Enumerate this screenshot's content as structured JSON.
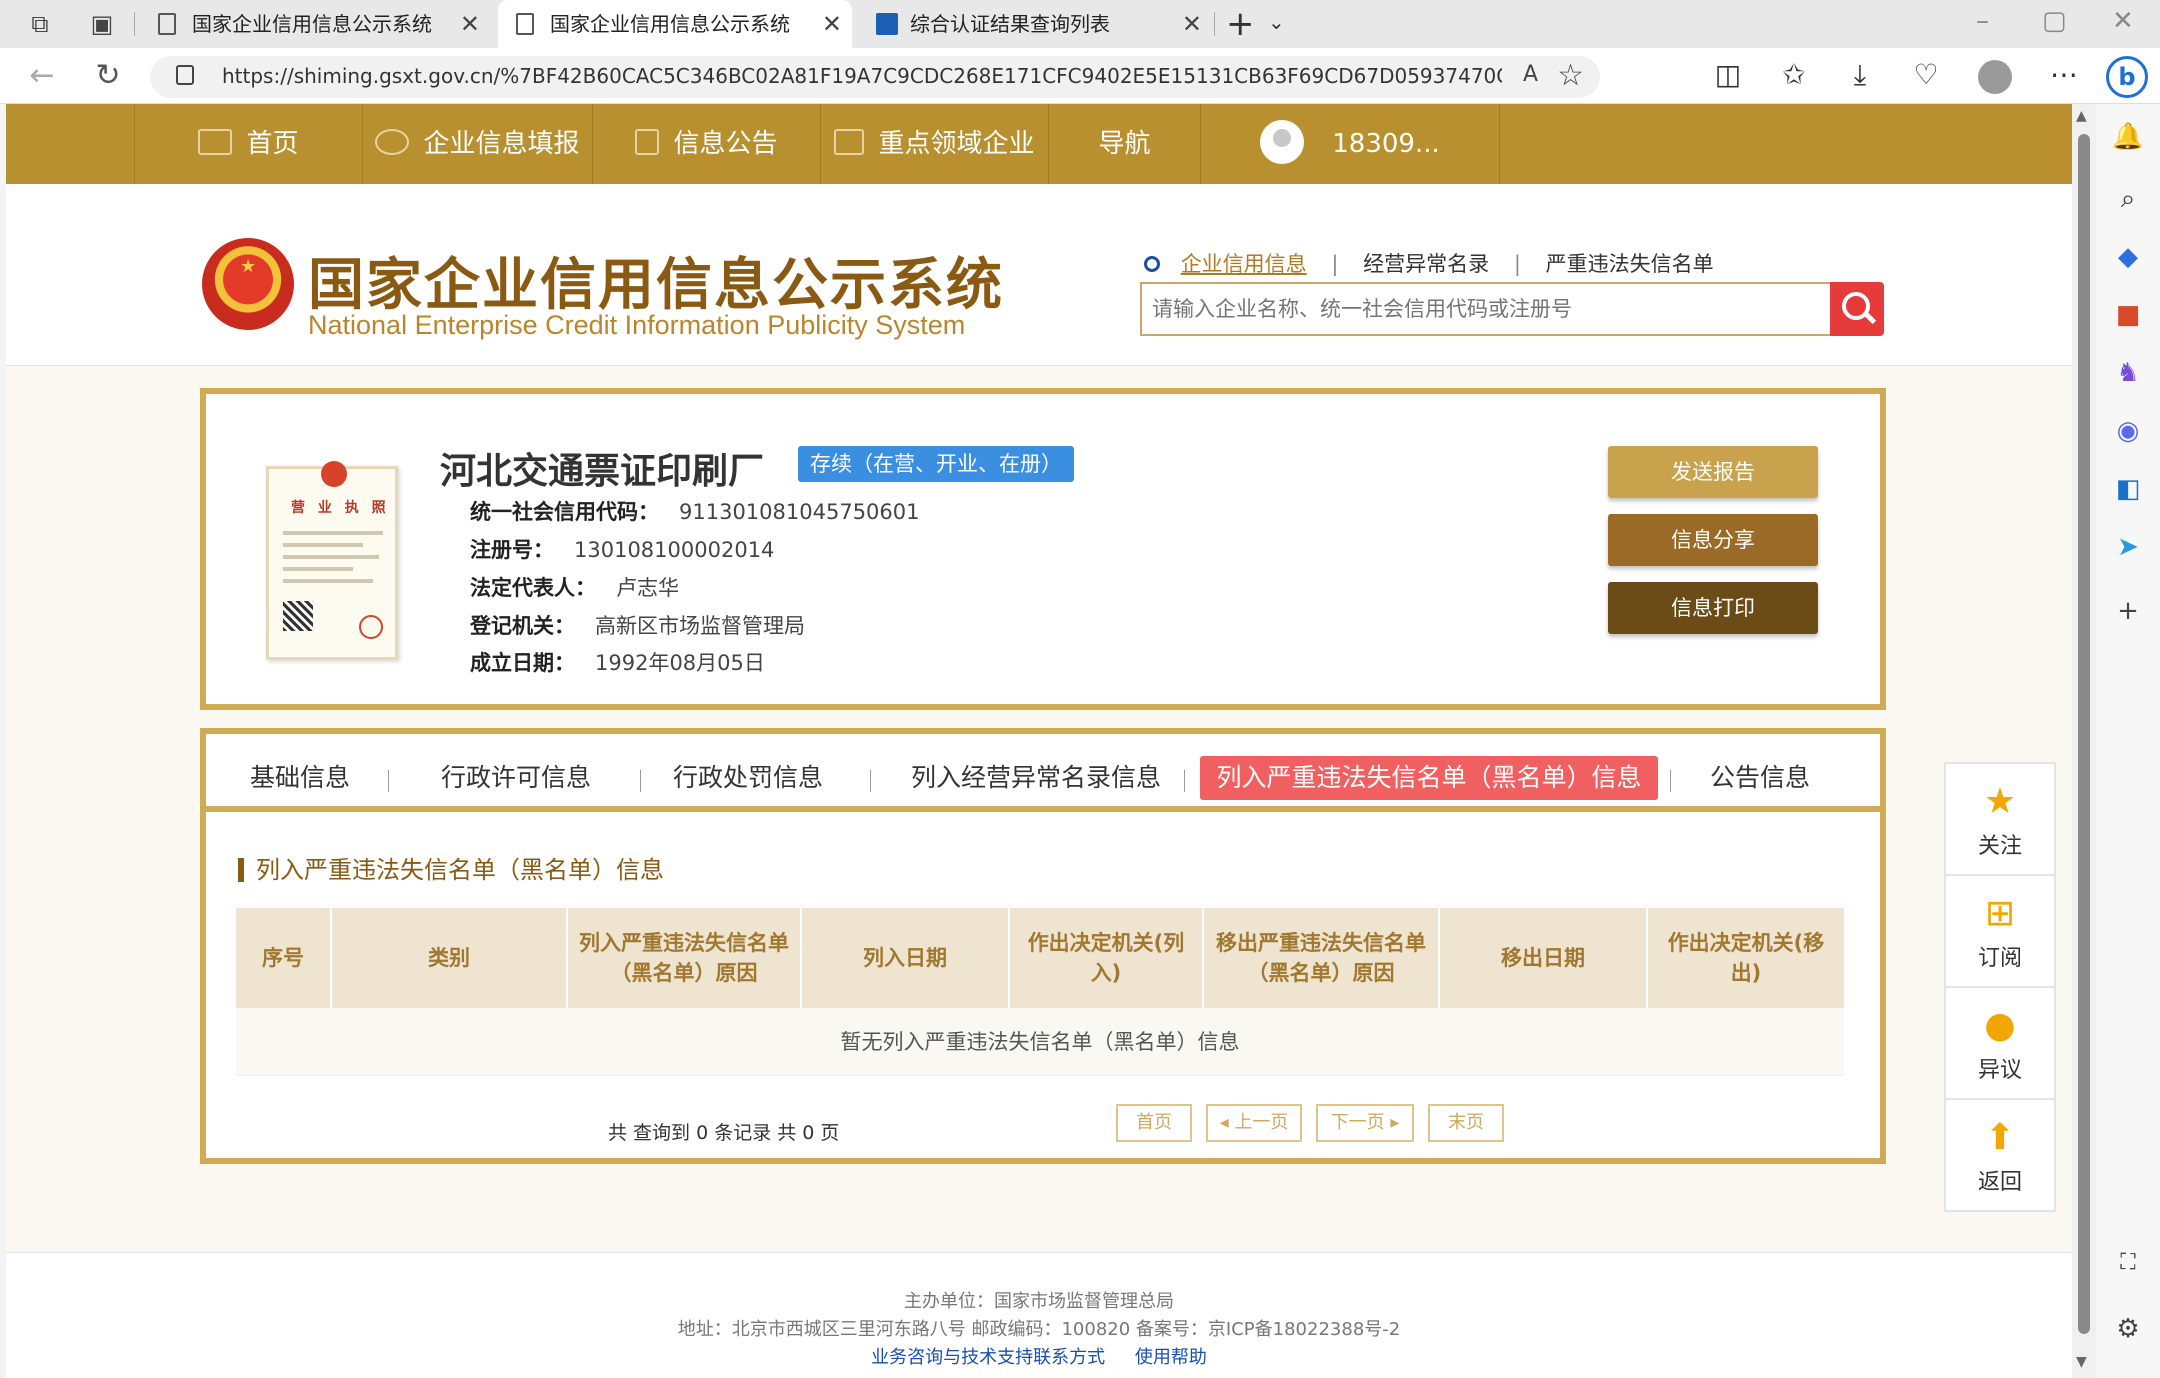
{
  "browser": {
    "tabs": [
      {
        "title": "国家企业信用信息公示系统",
        "close": "✕"
      },
      {
        "title": "国家企业信用信息公示系统",
        "close": "✕"
      },
      {
        "title": "综合认证结果查询列表",
        "close": "✕"
      }
    ],
    "url": "https://shiming.gsxt.gov.cn/%7BF42B60CAC5C346BC02A81F19A7C9CDC268E171CFC9402E5E15131CB63F69CD67D05937470C0A9A601A15EF..."
  },
  "nav": {
    "items": [
      "首页",
      "企业信息填报",
      "信息公告",
      "重点领域企业",
      "导航"
    ],
    "user": "18309..."
  },
  "header": {
    "title": "国家企业信用信息公示系统",
    "subtitle": "National Enterprise Credit Information Publicity System",
    "search_links": [
      "企业信用信息",
      "经营异常名录",
      "严重违法失信名单"
    ],
    "search_placeholder": "请输入企业名称、统一社会信用代码或注册号"
  },
  "company": {
    "name": "河北交通票证印刷厂",
    "status": "存续（在营、开业、在册）",
    "license_title": "营 业 执 照",
    "fields": [
      {
        "label": "统一社会信用代码：",
        "value": "911301081045750601"
      },
      {
        "label": "注册号：",
        "value": "130108100002014"
      },
      {
        "label": "法定代表人：",
        "value": "卢志华"
      },
      {
        "label": "登记机关：",
        "value": "高新区市场监督管理局"
      },
      {
        "label": "成立日期：",
        "value": "1992年08月05日"
      }
    ],
    "buttons": [
      {
        "label": "发送报告",
        "color": "#c9a24e"
      },
      {
        "label": "信息分享",
        "color": "#9a6a26"
      },
      {
        "label": "信息打印",
        "color": "#6b4c17"
      }
    ]
  },
  "tabs": {
    "items": [
      "基础信息",
      "行政许可信息",
      "行政处罚信息",
      "列入经营异常名录信息",
      "列入严重违法失信名单（黑名单）信息",
      "公告信息"
    ],
    "active_index": 4
  },
  "section": {
    "title": "列入严重违法失信名单（黑名单）信息",
    "columns": [
      "序号",
      "类别",
      "列入严重违法失信名单（黑名单）原因",
      "列入日期",
      "作出决定机关(列入)",
      "移出严重违法失信名单（黑名单）原因",
      "移出日期",
      "作出决定机关(移出)"
    ],
    "empty_text": "暂无列入严重违法失信名单（黑名单）信息",
    "pager_info": "共 查询到 0 条记录 共 0 页",
    "pager_buttons": [
      "首页",
      "◂ 上一页",
      "下一页 ▸",
      "末页"
    ]
  },
  "float_bar": [
    "关注",
    "订阅",
    "异议",
    "返回"
  ],
  "footer": {
    "line1": "主办单位：国家市场监督管理总局",
    "line2": "地址：北京市西城区三里河东路八号   邮政编码：100820   备案号：京ICP备18022388号-2",
    "links": [
      "业务咨询与技术支持联系方式",
      "使用帮助"
    ]
  },
  "colors": {
    "nav": "#b8902f",
    "accent": "#d0aa55",
    "active_tab": "#f06060",
    "status": "#3b8fe0"
  }
}
